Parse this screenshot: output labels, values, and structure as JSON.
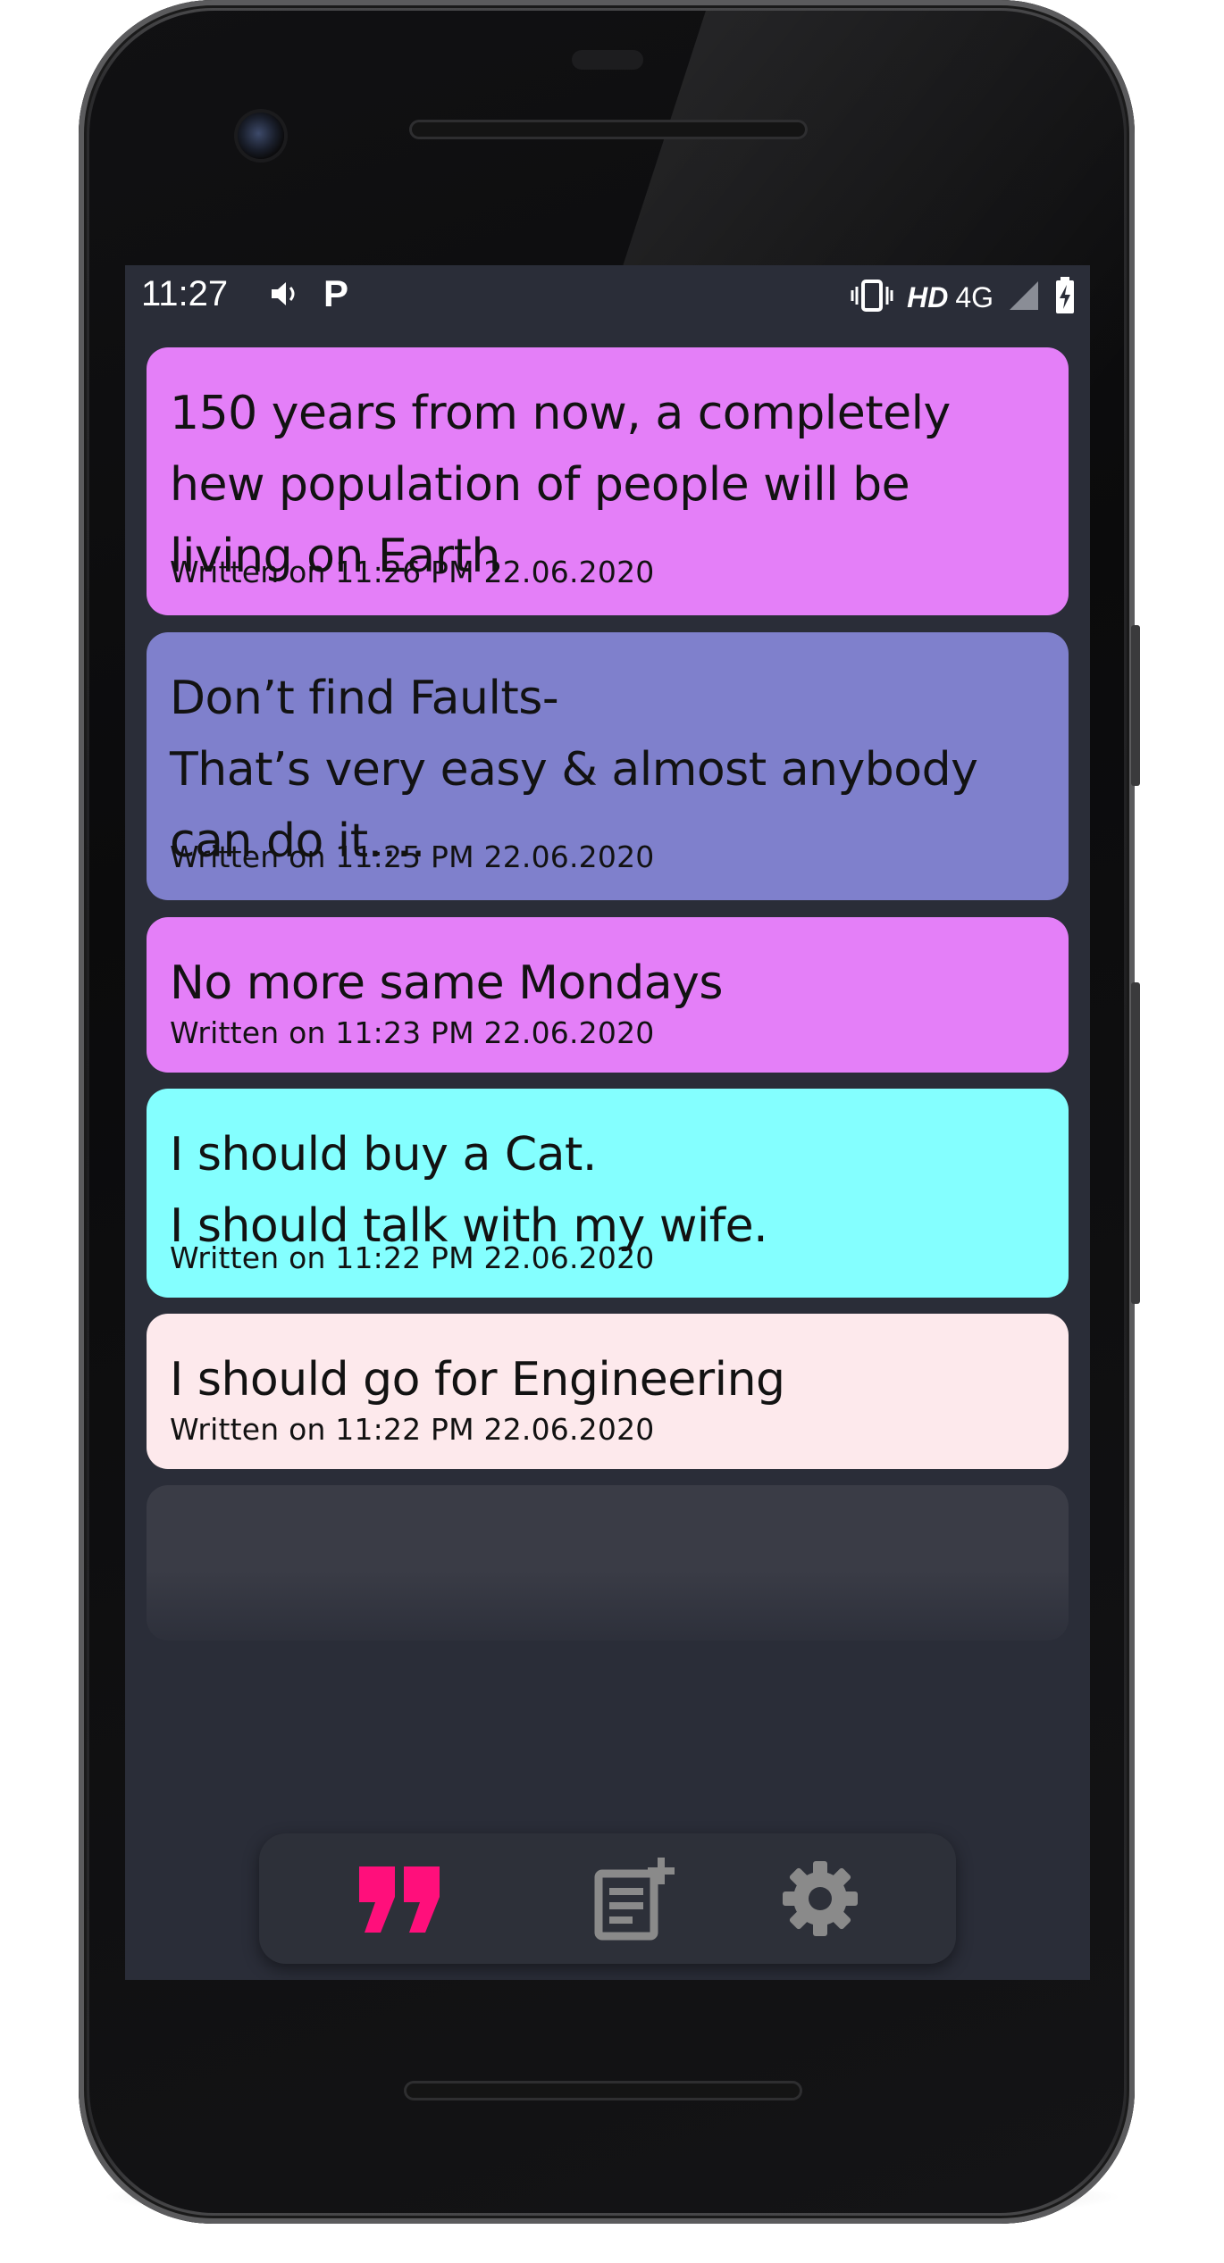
{
  "status_bar": {
    "time": "11:27",
    "sound_icon": "speaker-icon",
    "app_badge": "P",
    "vibrate_icon": "vibrate-icon",
    "hd_label": "HD",
    "network_label": "4G",
    "signal_icon": "signal-icon",
    "battery_icon": "battery-charging-icon"
  },
  "notes": [
    {
      "text": "150 years from now, a completely\nhew population of people will be\nliving on Earth",
      "date": "Written on 11:26 PM 22.06.2020",
      "color": "#e47ff8"
    },
    {
      "text": "Don’t find Faults-\nThat’s very easy & almost anybody\ncan do it....",
      "date": "Written on 11:25 PM 22.06.2020",
      "color": "#7f80cc"
    },
    {
      "text": "No more same Mondays",
      "date": "Written on 11:23 PM 22.06.2020",
      "color": "#e47ff8"
    },
    {
      "text": "I should buy a Cat.\nI should talk with my wife.",
      "date": "Written on 11:22 PM 22.06.2020",
      "color": "#84ffff"
    },
    {
      "text": "I should go for Engineering",
      "date": "Written on 11:22 PM 22.06.2020",
      "color": "#fde9ec"
    }
  ],
  "bottom_nav": {
    "items": [
      {
        "icon": "quotes-icon",
        "active": true,
        "color": "#ff0f7b"
      },
      {
        "icon": "add-note-icon",
        "active": false,
        "color": "#8a8a8a"
      },
      {
        "icon": "settings-gear-icon",
        "active": false,
        "color": "#8a8a8a"
      }
    ]
  },
  "colors": {
    "background": "#2a2d38",
    "accent": "#ff0f7b"
  }
}
